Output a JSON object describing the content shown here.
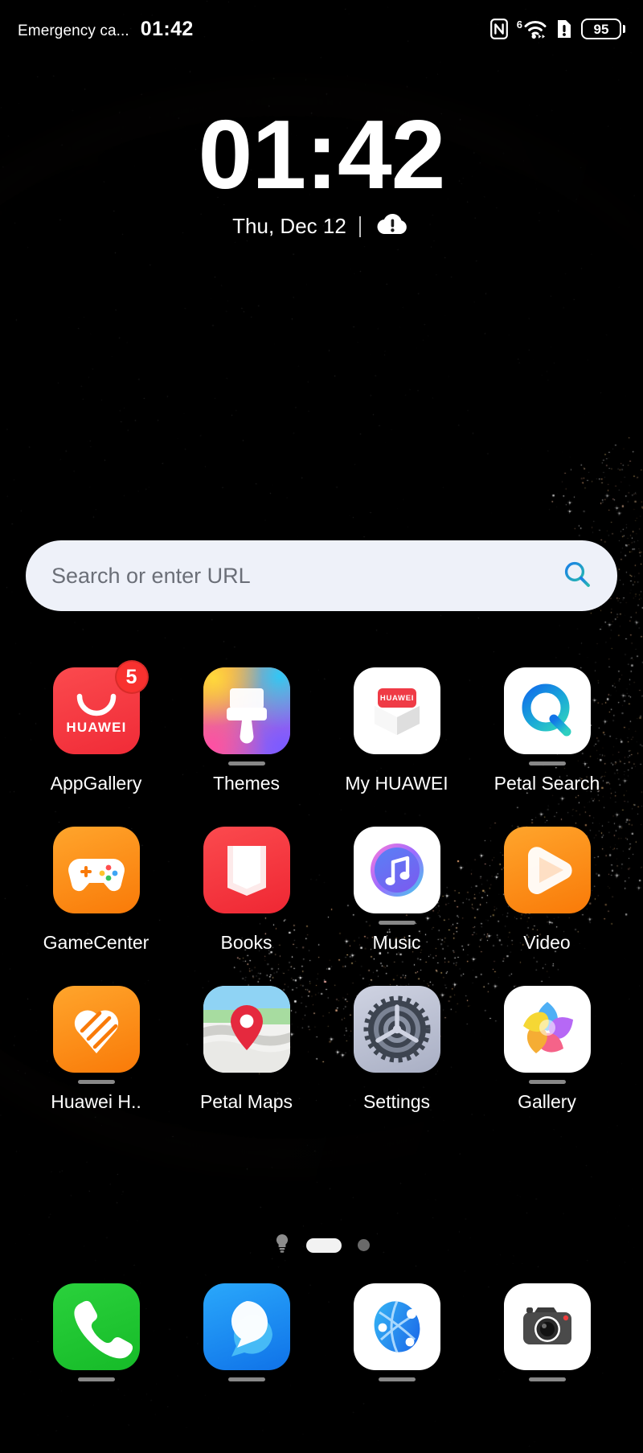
{
  "status_bar": {
    "carrier": "Emergency ca...",
    "time": "01:42",
    "icons": [
      "nfc-icon",
      "wifi-icon",
      "sim-alert-icon",
      "battery-icon"
    ],
    "wifi_generation": "6",
    "battery_level": "95"
  },
  "clock_widget": {
    "time": "01:42",
    "date": "Thu, Dec 12",
    "weather_icon": "cloud-alert-icon"
  },
  "search": {
    "placeholder": "Search or enter URL",
    "icon": "search-icon"
  },
  "app_grid": {
    "rows": [
      [
        {
          "label": "AppGallery",
          "icon": "appgallery-icon",
          "badge": "5",
          "update_bar": false
        },
        {
          "label": "Themes",
          "icon": "themes-icon",
          "badge": "",
          "update_bar": true
        },
        {
          "label": "My HUAWEI",
          "icon": "my-huawei-icon",
          "badge": "",
          "update_bar": false
        },
        {
          "label": "Petal Search",
          "icon": "petal-search-icon",
          "badge": "",
          "update_bar": true
        }
      ],
      [
        {
          "label": "GameCenter",
          "icon": "gamecenter-icon",
          "badge": "",
          "update_bar": false
        },
        {
          "label": "Books",
          "icon": "books-icon",
          "badge": "",
          "update_bar": false
        },
        {
          "label": "Music",
          "icon": "music-icon",
          "badge": "",
          "update_bar": true
        },
        {
          "label": "Video",
          "icon": "video-icon",
          "badge": "",
          "update_bar": false
        }
      ],
      [
        {
          "label": "Huawei H..",
          "icon": "huawei-health-icon",
          "badge": "",
          "update_bar": true
        },
        {
          "label": "Petal Maps",
          "icon": "petal-maps-icon",
          "badge": "",
          "update_bar": false
        },
        {
          "label": "Settings",
          "icon": "settings-icon",
          "badge": "",
          "update_bar": false
        },
        {
          "label": "Gallery",
          "icon": "gallery-icon",
          "badge": "",
          "update_bar": true
        }
      ]
    ]
  },
  "page_indicator": {
    "items": [
      "lightbulb-icon",
      "active-page-pill",
      "page-dot"
    ],
    "active_index": 1
  },
  "dock": {
    "items": [
      {
        "name": "Phone",
        "icon": "phone-icon"
      },
      {
        "name": "Messages",
        "icon": "messages-icon"
      },
      {
        "name": "Browser",
        "icon": "browser-icon"
      },
      {
        "name": "Camera",
        "icon": "camera-icon"
      }
    ]
  },
  "colors": {
    "background": "#000000",
    "search_bar": "#eef1f9",
    "search_placeholder": "#6b6f78",
    "badge_red": "#f8312f",
    "appgallery_red": "#f5363b",
    "gamecenter_orange": "#ff8c12",
    "books_red": "#f5363b",
    "video_orange": "#ff8c12",
    "health_orange": "#ff8c12",
    "phone_green": "#22c531",
    "messages_blue": "#1d93f5",
    "wallpaper_arc": "#e0b377"
  }
}
